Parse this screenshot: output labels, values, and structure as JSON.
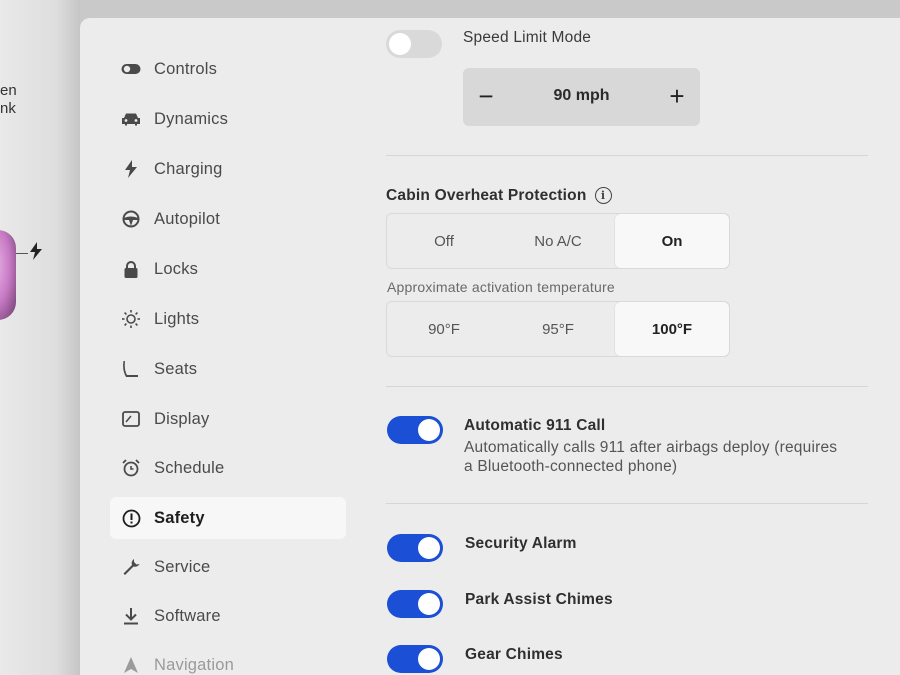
{
  "left_strip": {
    "text_line1": "en",
    "text_line2": "nk"
  },
  "sidebar": {
    "items": [
      {
        "label": "Controls",
        "icon": "toggle-icon"
      },
      {
        "label": "Dynamics",
        "icon": "car-icon"
      },
      {
        "label": "Charging",
        "icon": "bolt-icon"
      },
      {
        "label": "Autopilot",
        "icon": "steering-wheel-icon"
      },
      {
        "label": "Locks",
        "icon": "lock-icon"
      },
      {
        "label": "Lights",
        "icon": "light-icon"
      },
      {
        "label": "Seats",
        "icon": "seat-icon"
      },
      {
        "label": "Display",
        "icon": "display-icon"
      },
      {
        "label": "Schedule",
        "icon": "alarm-clock-icon"
      },
      {
        "label": "Safety",
        "icon": "alert-circle-icon",
        "active": true
      },
      {
        "label": "Service",
        "icon": "wrench-icon"
      },
      {
        "label": "Software",
        "icon": "download-icon"
      },
      {
        "label": "Navigation",
        "icon": "navigation-arrow-icon"
      }
    ]
  },
  "speed_limit": {
    "label": "Speed Limit Mode",
    "enabled": false,
    "minus": "−",
    "value": "90 mph",
    "plus": "+"
  },
  "cabin_overheat": {
    "label": "Cabin Overheat Protection",
    "info_glyph": "i",
    "options": [
      "Off",
      "No A/C",
      "On"
    ],
    "selected": "On",
    "temp_label": "Approximate activation temperature",
    "temp_options": [
      "90°F",
      "95°F",
      "100°F"
    ],
    "temp_selected": "100°F"
  },
  "auto_911": {
    "label": "Automatic 911 Call",
    "desc_line1": "Automatically calls 911 after airbags deploy (requires",
    "desc_line2": "a Bluetooth-connected phone)",
    "enabled": true
  },
  "security_alarm": {
    "label": "Security Alarm",
    "enabled": true
  },
  "park_assist": {
    "label": "Park Assist Chimes",
    "enabled": true
  },
  "gear_chimes": {
    "label": "Gear Chimes",
    "enabled": true
  },
  "colors": {
    "toggle_on": "#1a4fd6",
    "toggle_off": "#d9d9d9",
    "panel_bg": "#ececec"
  }
}
